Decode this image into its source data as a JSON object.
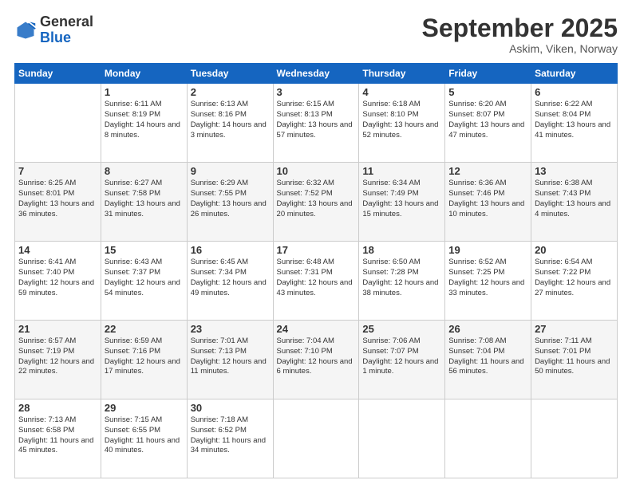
{
  "logo": {
    "general": "General",
    "blue": "Blue"
  },
  "header": {
    "month": "September 2025",
    "location": "Askim, Viken, Norway"
  },
  "weekdays": [
    "Sunday",
    "Monday",
    "Tuesday",
    "Wednesday",
    "Thursday",
    "Friday",
    "Saturday"
  ],
  "weeks": [
    [
      {
        "day": "",
        "sunrise": "",
        "sunset": "",
        "daylight": ""
      },
      {
        "day": "1",
        "sunrise": "Sunrise: 6:11 AM",
        "sunset": "Sunset: 8:19 PM",
        "daylight": "Daylight: 14 hours and 8 minutes."
      },
      {
        "day": "2",
        "sunrise": "Sunrise: 6:13 AM",
        "sunset": "Sunset: 8:16 PM",
        "daylight": "Daylight: 14 hours and 3 minutes."
      },
      {
        "day": "3",
        "sunrise": "Sunrise: 6:15 AM",
        "sunset": "Sunset: 8:13 PM",
        "daylight": "Daylight: 13 hours and 57 minutes."
      },
      {
        "day": "4",
        "sunrise": "Sunrise: 6:18 AM",
        "sunset": "Sunset: 8:10 PM",
        "daylight": "Daylight: 13 hours and 52 minutes."
      },
      {
        "day": "5",
        "sunrise": "Sunrise: 6:20 AM",
        "sunset": "Sunset: 8:07 PM",
        "daylight": "Daylight: 13 hours and 47 minutes."
      },
      {
        "day": "6",
        "sunrise": "Sunrise: 6:22 AM",
        "sunset": "Sunset: 8:04 PM",
        "daylight": "Daylight: 13 hours and 41 minutes."
      }
    ],
    [
      {
        "day": "7",
        "sunrise": "Sunrise: 6:25 AM",
        "sunset": "Sunset: 8:01 PM",
        "daylight": "Daylight: 13 hours and 36 minutes."
      },
      {
        "day": "8",
        "sunrise": "Sunrise: 6:27 AM",
        "sunset": "Sunset: 7:58 PM",
        "daylight": "Daylight: 13 hours and 31 minutes."
      },
      {
        "day": "9",
        "sunrise": "Sunrise: 6:29 AM",
        "sunset": "Sunset: 7:55 PM",
        "daylight": "Daylight: 13 hours and 26 minutes."
      },
      {
        "day": "10",
        "sunrise": "Sunrise: 6:32 AM",
        "sunset": "Sunset: 7:52 PM",
        "daylight": "Daylight: 13 hours and 20 minutes."
      },
      {
        "day": "11",
        "sunrise": "Sunrise: 6:34 AM",
        "sunset": "Sunset: 7:49 PM",
        "daylight": "Daylight: 13 hours and 15 minutes."
      },
      {
        "day": "12",
        "sunrise": "Sunrise: 6:36 AM",
        "sunset": "Sunset: 7:46 PM",
        "daylight": "Daylight: 13 hours and 10 minutes."
      },
      {
        "day": "13",
        "sunrise": "Sunrise: 6:38 AM",
        "sunset": "Sunset: 7:43 PM",
        "daylight": "Daylight: 13 hours and 4 minutes."
      }
    ],
    [
      {
        "day": "14",
        "sunrise": "Sunrise: 6:41 AM",
        "sunset": "Sunset: 7:40 PM",
        "daylight": "Daylight: 12 hours and 59 minutes."
      },
      {
        "day": "15",
        "sunrise": "Sunrise: 6:43 AM",
        "sunset": "Sunset: 7:37 PM",
        "daylight": "Daylight: 12 hours and 54 minutes."
      },
      {
        "day": "16",
        "sunrise": "Sunrise: 6:45 AM",
        "sunset": "Sunset: 7:34 PM",
        "daylight": "Daylight: 12 hours and 49 minutes."
      },
      {
        "day": "17",
        "sunrise": "Sunrise: 6:48 AM",
        "sunset": "Sunset: 7:31 PM",
        "daylight": "Daylight: 12 hours and 43 minutes."
      },
      {
        "day": "18",
        "sunrise": "Sunrise: 6:50 AM",
        "sunset": "Sunset: 7:28 PM",
        "daylight": "Daylight: 12 hours and 38 minutes."
      },
      {
        "day": "19",
        "sunrise": "Sunrise: 6:52 AM",
        "sunset": "Sunset: 7:25 PM",
        "daylight": "Daylight: 12 hours and 33 minutes."
      },
      {
        "day": "20",
        "sunrise": "Sunrise: 6:54 AM",
        "sunset": "Sunset: 7:22 PM",
        "daylight": "Daylight: 12 hours and 27 minutes."
      }
    ],
    [
      {
        "day": "21",
        "sunrise": "Sunrise: 6:57 AM",
        "sunset": "Sunset: 7:19 PM",
        "daylight": "Daylight: 12 hours and 22 minutes."
      },
      {
        "day": "22",
        "sunrise": "Sunrise: 6:59 AM",
        "sunset": "Sunset: 7:16 PM",
        "daylight": "Daylight: 12 hours and 17 minutes."
      },
      {
        "day": "23",
        "sunrise": "Sunrise: 7:01 AM",
        "sunset": "Sunset: 7:13 PM",
        "daylight": "Daylight: 12 hours and 11 minutes."
      },
      {
        "day": "24",
        "sunrise": "Sunrise: 7:04 AM",
        "sunset": "Sunset: 7:10 PM",
        "daylight": "Daylight: 12 hours and 6 minutes."
      },
      {
        "day": "25",
        "sunrise": "Sunrise: 7:06 AM",
        "sunset": "Sunset: 7:07 PM",
        "daylight": "Daylight: 12 hours and 1 minute."
      },
      {
        "day": "26",
        "sunrise": "Sunrise: 7:08 AM",
        "sunset": "Sunset: 7:04 PM",
        "daylight": "Daylight: 11 hours and 56 minutes."
      },
      {
        "day": "27",
        "sunrise": "Sunrise: 7:11 AM",
        "sunset": "Sunset: 7:01 PM",
        "daylight": "Daylight: 11 hours and 50 minutes."
      }
    ],
    [
      {
        "day": "28",
        "sunrise": "Sunrise: 7:13 AM",
        "sunset": "Sunset: 6:58 PM",
        "daylight": "Daylight: 11 hours and 45 minutes."
      },
      {
        "day": "29",
        "sunrise": "Sunrise: 7:15 AM",
        "sunset": "Sunset: 6:55 PM",
        "daylight": "Daylight: 11 hours and 40 minutes."
      },
      {
        "day": "30",
        "sunrise": "Sunrise: 7:18 AM",
        "sunset": "Sunset: 6:52 PM",
        "daylight": "Daylight: 11 hours and 34 minutes."
      },
      {
        "day": "",
        "sunrise": "",
        "sunset": "",
        "daylight": ""
      },
      {
        "day": "",
        "sunrise": "",
        "sunset": "",
        "daylight": ""
      },
      {
        "day": "",
        "sunrise": "",
        "sunset": "",
        "daylight": ""
      },
      {
        "day": "",
        "sunrise": "",
        "sunset": "",
        "daylight": ""
      }
    ]
  ]
}
